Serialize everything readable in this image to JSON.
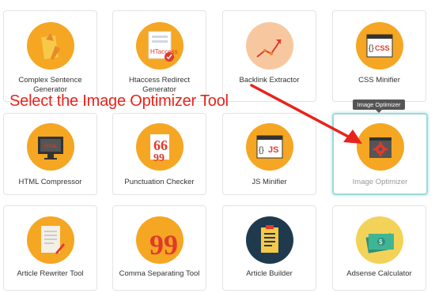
{
  "tools": [
    {
      "label": "Complex Sentence Generator",
      "icon": "pencils-icon",
      "color": "#f5a623"
    },
    {
      "label": "Htaccess Redirect Generator",
      "icon": "htaccess-file-icon",
      "color": "#f5a623"
    },
    {
      "label": "Backlink Extractor",
      "icon": "growth-chart-icon",
      "color": "#f5a623"
    },
    {
      "label": "CSS Minifier",
      "icon": "css-file-icon",
      "color": "#f5a623"
    },
    {
      "label": "HTML Compressor",
      "icon": "html-monitor-icon",
      "color": "#f5a623"
    },
    {
      "label": "Punctuation Checker",
      "icon": "quote-marks-icon",
      "color": "#f5a623"
    },
    {
      "label": "JS Minifier",
      "icon": "js-file-icon",
      "color": "#f5a623"
    },
    {
      "label": "Image Optimizer",
      "icon": "gear-window-icon",
      "color": "#f5a623"
    },
    {
      "label": "Article Rewriter Tool",
      "icon": "document-pen-icon",
      "color": "#f5a623"
    },
    {
      "label": "Comma Separating Tool",
      "icon": "comma-quote-icon",
      "color": "#e03a2c"
    },
    {
      "label": "Article Builder",
      "icon": "clipboard-list-icon",
      "color": "#1f3a4d"
    },
    {
      "label": "Adsense Calculator",
      "icon": "money-stack-icon",
      "color": "#f3d25a"
    }
  ],
  "annotation": "Select the Image Optimizer Tool",
  "tooltip": "Image Optimizer",
  "colors": {
    "accent_red": "#e8231c",
    "active_border": "#9fd8dc"
  }
}
